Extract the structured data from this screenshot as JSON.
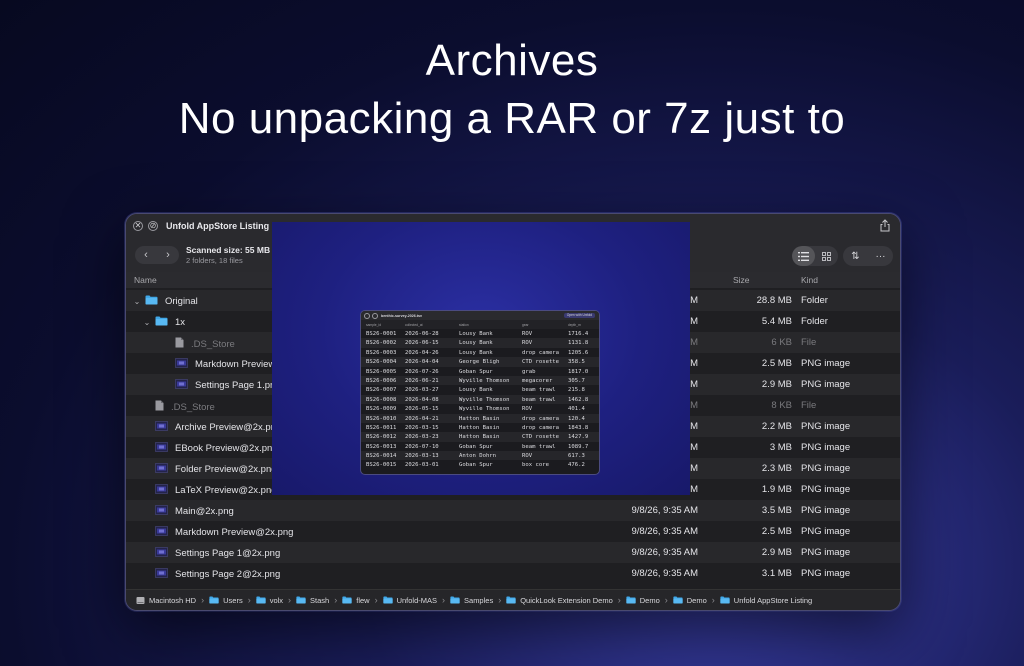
{
  "headline": {
    "line1": "Archives",
    "line2": "No unpacking a RAR or 7z just to"
  },
  "window": {
    "title": "Unfold AppStore Listing",
    "scan_title": "Scanned size: 55 MB",
    "scan_sub": "2 folders, 18 files",
    "columns": {
      "name": "Name",
      "size": "Size",
      "kind": "Kind"
    }
  },
  "rows": [
    {
      "name": "Original",
      "date": "AM",
      "size": "28.8 MB",
      "kind": "Folder",
      "icon": "folder-icon",
      "indent": 0,
      "chevron": true,
      "dim": false
    },
    {
      "name": "1x",
      "date": "AM",
      "size": "5.4 MB",
      "kind": "Folder",
      "icon": "folder-icon",
      "indent": 1,
      "chevron": true,
      "dim": false
    },
    {
      "name": ".DS_Store",
      "date": "AM",
      "size": "6 KB",
      "kind": "File",
      "icon": "file-icon",
      "indent": 2,
      "chevron": false,
      "dim": true
    },
    {
      "name": "Markdown Preview.p",
      "date": "AM",
      "size": "2.5 MB",
      "kind": "PNG image",
      "icon": "image-icon",
      "indent": 2,
      "chevron": false,
      "dim": false
    },
    {
      "name": "Settings Page 1.png",
      "date": "AM",
      "size": "2.9 MB",
      "kind": "PNG image",
      "icon": "image-icon",
      "indent": 2,
      "chevron": false,
      "dim": false
    },
    {
      "name": ".DS_Store",
      "date": "AM",
      "size": "8 KB",
      "kind": "File",
      "icon": "file-icon",
      "indent": 1,
      "chevron": false,
      "dim": true
    },
    {
      "name": "Archive Preview@2x.pn",
      "date": "AM",
      "size": "2.2 MB",
      "kind": "PNG image",
      "icon": "image-icon",
      "indent": 1,
      "chevron": false,
      "dim": false
    },
    {
      "name": "EBook Preview@2x.png",
      "date": "AM",
      "size": "3 MB",
      "kind": "PNG image",
      "icon": "image-icon",
      "indent": 1,
      "chevron": false,
      "dim": false
    },
    {
      "name": "Folder Preview@2x.png",
      "date": "AM",
      "size": "2.3 MB",
      "kind": "PNG image",
      "icon": "image-icon",
      "indent": 1,
      "chevron": false,
      "dim": false
    },
    {
      "name": "LaTeX Preview@2x.png",
      "date": "AM",
      "size": "1.9 MB",
      "kind": "PNG image",
      "icon": "image-icon",
      "indent": 1,
      "chevron": false,
      "dim": false
    },
    {
      "name": "Main@2x.png",
      "date": "9/8/26, 9:35 AM",
      "size": "3.5 MB",
      "kind": "PNG image",
      "icon": "image-icon",
      "indent": 1,
      "chevron": false,
      "dim": false
    },
    {
      "name": "Markdown Preview@2x.png",
      "date": "9/8/26, 9:35 AM",
      "size": "2.5 MB",
      "kind": "PNG image",
      "icon": "image-icon",
      "indent": 1,
      "chevron": false,
      "dim": false
    },
    {
      "name": "Settings Page 1@2x.png",
      "date": "9/8/26, 9:35 AM",
      "size": "2.9 MB",
      "kind": "PNG image",
      "icon": "image-icon",
      "indent": 1,
      "chevron": false,
      "dim": false
    },
    {
      "name": "Settings Page 2@2x.png",
      "date": "9/8/26, 9:35 AM",
      "size": "3.1 MB",
      "kind": "PNG image",
      "icon": "image-icon",
      "indent": 1,
      "chevron": false,
      "dim": false
    }
  ],
  "path": [
    "Macintosh HD",
    "Users",
    "volx",
    "Stash",
    "flew",
    "Unfold-MAS",
    "Samples",
    "QuickLook Extension Demo",
    "Demo",
    "Demo",
    "Unfold AppStore Listing"
  ],
  "preview": {
    "title": "benthic-survey-2026.tsv",
    "open_label": "Open with Unfold",
    "columns": [
      "sample_id",
      "collected_at",
      "station",
      "gear",
      "depth_m"
    ],
    "rows": [
      [
        "BS26-0001",
        "2026-06-28",
        "Lousy Bank",
        "ROV",
        "1716.4"
      ],
      [
        "BS26-0002",
        "2026-06-15",
        "Lousy Bank",
        "ROV",
        "1131.8"
      ],
      [
        "BS26-0003",
        "2026-04-26",
        "Lousy Bank",
        "drop camera",
        "1205.6"
      ],
      [
        "BS26-0004",
        "2026-04-04",
        "George Bligh",
        "CTD rosette",
        "358.5"
      ],
      [
        "BS26-0005",
        "2026-07-26",
        "Goban Spur",
        "grab",
        "1817.0"
      ],
      [
        "BS26-0006",
        "2026-06-21",
        "Wyville Thomson",
        "megacorer",
        "305.7"
      ],
      [
        "BS26-0007",
        "2026-03-27",
        "Lousy Bank",
        "beam trawl",
        "215.8"
      ],
      [
        "BS26-0008",
        "2026-04-08",
        "Wyville Thomson",
        "beam trawl",
        "1462.8"
      ],
      [
        "BS26-0009",
        "2026-05-15",
        "Wyville Thomson",
        "ROV",
        "401.4"
      ],
      [
        "BS26-0010",
        "2026-04-21",
        "Hatton Basin",
        "drop camera",
        "120.4"
      ],
      [
        "BS26-0011",
        "2026-03-15",
        "Hatton Basin",
        "drop camera",
        "1843.8"
      ],
      [
        "BS26-0012",
        "2026-03-23",
        "Hatton Basin",
        "CTD rosette",
        "1427.9"
      ],
      [
        "BS26-0013",
        "2026-07-10",
        "Goban Spur",
        "beam trawl",
        "1089.7"
      ],
      [
        "BS26-0014",
        "2026-03-13",
        "Anton Dohrn",
        "ROV",
        "617.3"
      ],
      [
        "BS26-0015",
        "2026-03-01",
        "Goban Spur",
        "box core",
        "476.2"
      ]
    ]
  }
}
